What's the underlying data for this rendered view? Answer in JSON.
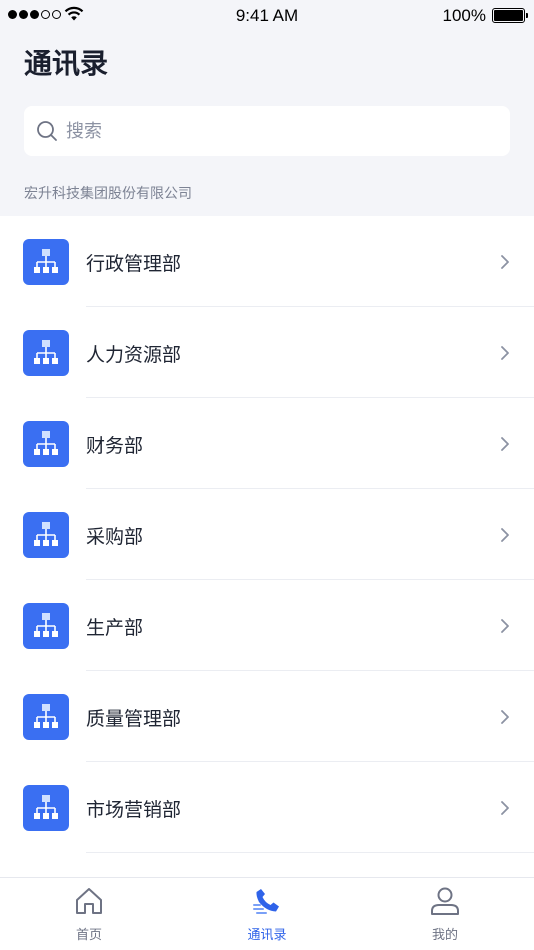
{
  "status_bar": {
    "time": "9:41 AM",
    "battery": "100%",
    "signal_bars_filled": 3,
    "signal_bars_total": 5
  },
  "header": {
    "title": "通讯录"
  },
  "search": {
    "placeholder": "搜索",
    "icon": "search-icon"
  },
  "company": {
    "name": "宏升科技集团股份有限公司"
  },
  "departments": [
    {
      "label": "行政管理部",
      "icon": "org-chart-icon"
    },
    {
      "label": "人力资源部",
      "icon": "org-chart-icon"
    },
    {
      "label": "财务部",
      "icon": "org-chart-icon"
    },
    {
      "label": "采购部",
      "icon": "org-chart-icon"
    },
    {
      "label": "生产部",
      "icon": "org-chart-icon"
    },
    {
      "label": "质量管理部",
      "icon": "org-chart-icon"
    },
    {
      "label": "市场营销部",
      "icon": "org-chart-icon"
    }
  ],
  "tab_bar": {
    "tabs": [
      {
        "label": "首页",
        "icon": "home-icon",
        "active": false
      },
      {
        "label": "通讯录",
        "icon": "phone-icon",
        "active": true
      },
      {
        "label": "我的",
        "icon": "user-icon",
        "active": false
      }
    ]
  },
  "colors": {
    "accent": "#2f63e9",
    "icon_bg": "#3a6ff2",
    "header_bg": "#f4f5f9",
    "divider": "#ebedf2",
    "muted_text": "#7d8394"
  }
}
